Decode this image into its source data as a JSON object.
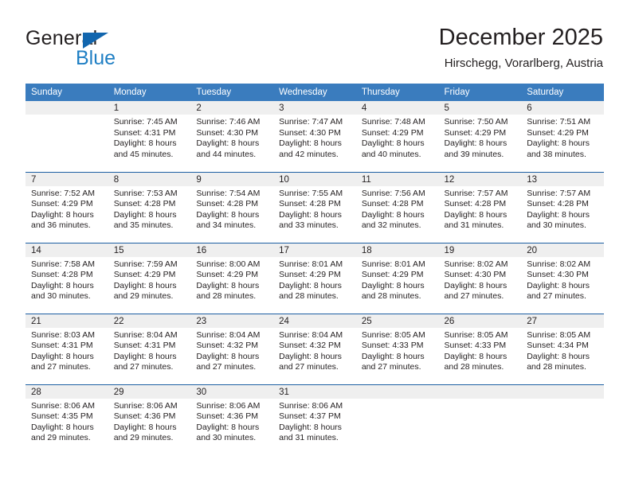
{
  "logo": {
    "word_top": "General",
    "word_bottom": "Blue",
    "triangle_color": "#1266ae",
    "blue_color": "#1f7fc4"
  },
  "header": {
    "title": "December 2025",
    "subtitle": "Hirschegg, Vorarlberg, Austria"
  },
  "theme": {
    "header_bg": "#3a7cbe",
    "header_text": "#ffffff",
    "row_divider": "#1d5fa3",
    "datenum_bg": "#efefef",
    "body_text": "#231f20"
  },
  "calendar": {
    "weekday_headers": [
      "Sunday",
      "Monday",
      "Tuesday",
      "Wednesday",
      "Thursday",
      "Friday",
      "Saturday"
    ],
    "weeks": [
      [
        {
          "date": "",
          "empty": true,
          "sunrise": "",
          "sunset": "",
          "daylight_line1": "",
          "daylight_line2": ""
        },
        {
          "date": "1",
          "empty": false,
          "sunrise": "Sunrise: 7:45 AM",
          "sunset": "Sunset: 4:31 PM",
          "daylight_line1": "Daylight: 8 hours",
          "daylight_line2": "and 45 minutes."
        },
        {
          "date": "2",
          "empty": false,
          "sunrise": "Sunrise: 7:46 AM",
          "sunset": "Sunset: 4:30 PM",
          "daylight_line1": "Daylight: 8 hours",
          "daylight_line2": "and 44 minutes."
        },
        {
          "date": "3",
          "empty": false,
          "sunrise": "Sunrise: 7:47 AM",
          "sunset": "Sunset: 4:30 PM",
          "daylight_line1": "Daylight: 8 hours",
          "daylight_line2": "and 42 minutes."
        },
        {
          "date": "4",
          "empty": false,
          "sunrise": "Sunrise: 7:48 AM",
          "sunset": "Sunset: 4:29 PM",
          "daylight_line1": "Daylight: 8 hours",
          "daylight_line2": "and 40 minutes."
        },
        {
          "date": "5",
          "empty": false,
          "sunrise": "Sunrise: 7:50 AM",
          "sunset": "Sunset: 4:29 PM",
          "daylight_line1": "Daylight: 8 hours",
          "daylight_line2": "and 39 minutes."
        },
        {
          "date": "6",
          "empty": false,
          "sunrise": "Sunrise: 7:51 AM",
          "sunset": "Sunset: 4:29 PM",
          "daylight_line1": "Daylight: 8 hours",
          "daylight_line2": "and 38 minutes."
        }
      ],
      [
        {
          "date": "7",
          "empty": false,
          "sunrise": "Sunrise: 7:52 AM",
          "sunset": "Sunset: 4:29 PM",
          "daylight_line1": "Daylight: 8 hours",
          "daylight_line2": "and 36 minutes."
        },
        {
          "date": "8",
          "empty": false,
          "sunrise": "Sunrise: 7:53 AM",
          "sunset": "Sunset: 4:28 PM",
          "daylight_line1": "Daylight: 8 hours",
          "daylight_line2": "and 35 minutes."
        },
        {
          "date": "9",
          "empty": false,
          "sunrise": "Sunrise: 7:54 AM",
          "sunset": "Sunset: 4:28 PM",
          "daylight_line1": "Daylight: 8 hours",
          "daylight_line2": "and 34 minutes."
        },
        {
          "date": "10",
          "empty": false,
          "sunrise": "Sunrise: 7:55 AM",
          "sunset": "Sunset: 4:28 PM",
          "daylight_line1": "Daylight: 8 hours",
          "daylight_line2": "and 33 minutes."
        },
        {
          "date": "11",
          "empty": false,
          "sunrise": "Sunrise: 7:56 AM",
          "sunset": "Sunset: 4:28 PM",
          "daylight_line1": "Daylight: 8 hours",
          "daylight_line2": "and 32 minutes."
        },
        {
          "date": "12",
          "empty": false,
          "sunrise": "Sunrise: 7:57 AM",
          "sunset": "Sunset: 4:28 PM",
          "daylight_line1": "Daylight: 8 hours",
          "daylight_line2": "and 31 minutes."
        },
        {
          "date": "13",
          "empty": false,
          "sunrise": "Sunrise: 7:57 AM",
          "sunset": "Sunset: 4:28 PM",
          "daylight_line1": "Daylight: 8 hours",
          "daylight_line2": "and 30 minutes."
        }
      ],
      [
        {
          "date": "14",
          "empty": false,
          "sunrise": "Sunrise: 7:58 AM",
          "sunset": "Sunset: 4:28 PM",
          "daylight_line1": "Daylight: 8 hours",
          "daylight_line2": "and 30 minutes."
        },
        {
          "date": "15",
          "empty": false,
          "sunrise": "Sunrise: 7:59 AM",
          "sunset": "Sunset: 4:29 PM",
          "daylight_line1": "Daylight: 8 hours",
          "daylight_line2": "and 29 minutes."
        },
        {
          "date": "16",
          "empty": false,
          "sunrise": "Sunrise: 8:00 AM",
          "sunset": "Sunset: 4:29 PM",
          "daylight_line1": "Daylight: 8 hours",
          "daylight_line2": "and 28 minutes."
        },
        {
          "date": "17",
          "empty": false,
          "sunrise": "Sunrise: 8:01 AM",
          "sunset": "Sunset: 4:29 PM",
          "daylight_line1": "Daylight: 8 hours",
          "daylight_line2": "and 28 minutes."
        },
        {
          "date": "18",
          "empty": false,
          "sunrise": "Sunrise: 8:01 AM",
          "sunset": "Sunset: 4:29 PM",
          "daylight_line1": "Daylight: 8 hours",
          "daylight_line2": "and 28 minutes."
        },
        {
          "date": "19",
          "empty": false,
          "sunrise": "Sunrise: 8:02 AM",
          "sunset": "Sunset: 4:30 PM",
          "daylight_line1": "Daylight: 8 hours",
          "daylight_line2": "and 27 minutes."
        },
        {
          "date": "20",
          "empty": false,
          "sunrise": "Sunrise: 8:02 AM",
          "sunset": "Sunset: 4:30 PM",
          "daylight_line1": "Daylight: 8 hours",
          "daylight_line2": "and 27 minutes."
        }
      ],
      [
        {
          "date": "21",
          "empty": false,
          "sunrise": "Sunrise: 8:03 AM",
          "sunset": "Sunset: 4:31 PM",
          "daylight_line1": "Daylight: 8 hours",
          "daylight_line2": "and 27 minutes."
        },
        {
          "date": "22",
          "empty": false,
          "sunrise": "Sunrise: 8:04 AM",
          "sunset": "Sunset: 4:31 PM",
          "daylight_line1": "Daylight: 8 hours",
          "daylight_line2": "and 27 minutes."
        },
        {
          "date": "23",
          "empty": false,
          "sunrise": "Sunrise: 8:04 AM",
          "sunset": "Sunset: 4:32 PM",
          "daylight_line1": "Daylight: 8 hours",
          "daylight_line2": "and 27 minutes."
        },
        {
          "date": "24",
          "empty": false,
          "sunrise": "Sunrise: 8:04 AM",
          "sunset": "Sunset: 4:32 PM",
          "daylight_line1": "Daylight: 8 hours",
          "daylight_line2": "and 27 minutes."
        },
        {
          "date": "25",
          "empty": false,
          "sunrise": "Sunrise: 8:05 AM",
          "sunset": "Sunset: 4:33 PM",
          "daylight_line1": "Daylight: 8 hours",
          "daylight_line2": "and 27 minutes."
        },
        {
          "date": "26",
          "empty": false,
          "sunrise": "Sunrise: 8:05 AM",
          "sunset": "Sunset: 4:33 PM",
          "daylight_line1": "Daylight: 8 hours",
          "daylight_line2": "and 28 minutes."
        },
        {
          "date": "27",
          "empty": false,
          "sunrise": "Sunrise: 8:05 AM",
          "sunset": "Sunset: 4:34 PM",
          "daylight_line1": "Daylight: 8 hours",
          "daylight_line2": "and 28 minutes."
        }
      ],
      [
        {
          "date": "28",
          "empty": false,
          "sunrise": "Sunrise: 8:06 AM",
          "sunset": "Sunset: 4:35 PM",
          "daylight_line1": "Daylight: 8 hours",
          "daylight_line2": "and 29 minutes."
        },
        {
          "date": "29",
          "empty": false,
          "sunrise": "Sunrise: 8:06 AM",
          "sunset": "Sunset: 4:36 PM",
          "daylight_line1": "Daylight: 8 hours",
          "daylight_line2": "and 29 minutes."
        },
        {
          "date": "30",
          "empty": false,
          "sunrise": "Sunrise: 8:06 AM",
          "sunset": "Sunset: 4:36 PM",
          "daylight_line1": "Daylight: 8 hours",
          "daylight_line2": "and 30 minutes."
        },
        {
          "date": "31",
          "empty": false,
          "sunrise": "Sunrise: 8:06 AM",
          "sunset": "Sunset: 4:37 PM",
          "daylight_line1": "Daylight: 8 hours",
          "daylight_line2": "and 31 minutes."
        },
        {
          "date": "",
          "empty": true,
          "sunrise": "",
          "sunset": "",
          "daylight_line1": "",
          "daylight_line2": ""
        },
        {
          "date": "",
          "empty": true,
          "sunrise": "",
          "sunset": "",
          "daylight_line1": "",
          "daylight_line2": ""
        },
        {
          "date": "",
          "empty": true,
          "sunrise": "",
          "sunset": "",
          "daylight_line1": "",
          "daylight_line2": ""
        }
      ]
    ]
  }
}
